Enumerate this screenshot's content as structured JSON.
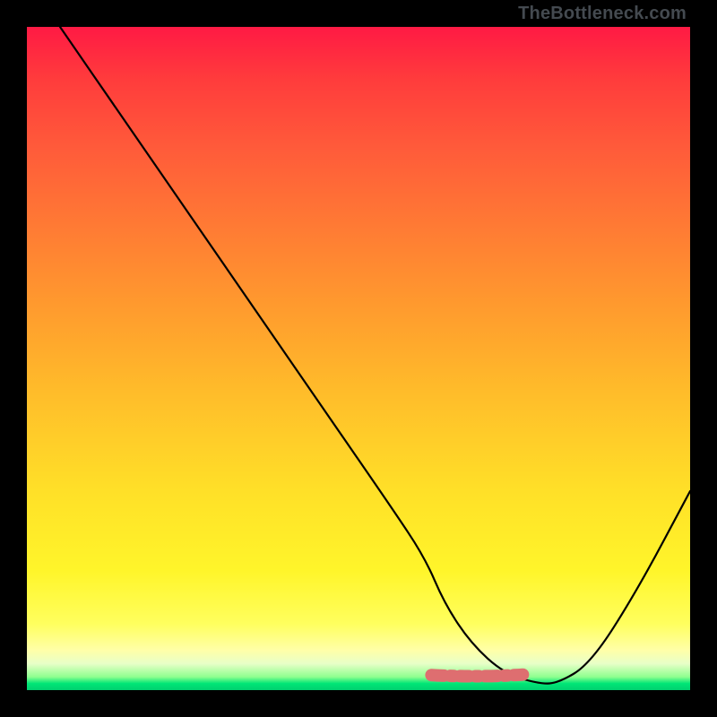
{
  "watermark": "TheBottleneck.com",
  "chart_data": {
    "type": "line",
    "title": "",
    "xlabel": "",
    "ylabel": "",
    "xlim": [
      0,
      100
    ],
    "ylim": [
      0,
      100
    ],
    "grid": false,
    "legend": false,
    "curve": {
      "x": [
        5,
        15,
        25,
        35,
        45,
        55,
        60,
        63,
        67,
        72,
        77,
        80,
        85,
        92,
        100
      ],
      "y": [
        100,
        85.5,
        71,
        56.5,
        42,
        27.5,
        20,
        13,
        7,
        2.5,
        1,
        1,
        4,
        15,
        30
      ]
    },
    "pink_band": {
      "x_start": 61,
      "x_end": 80,
      "y": 2
    },
    "background_gradient": {
      "top": "#ff1a44",
      "bottom": "#00d070"
    },
    "border_color": "#000000"
  }
}
